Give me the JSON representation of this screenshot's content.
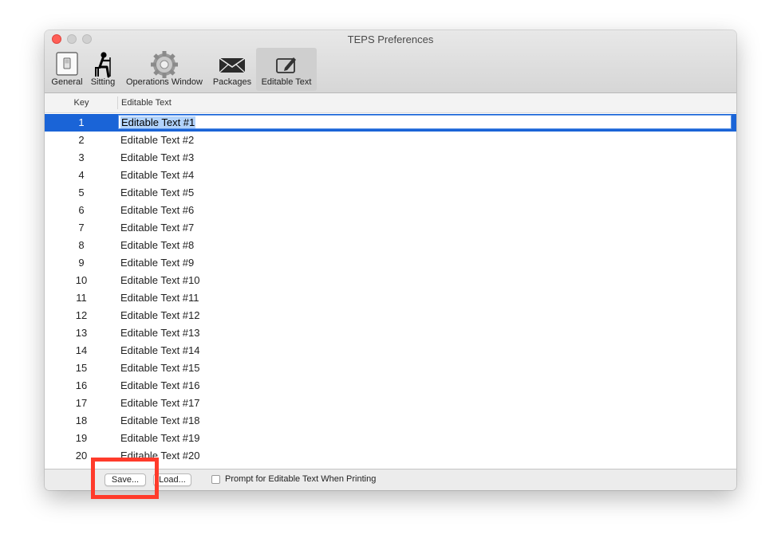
{
  "window": {
    "title": "TEPS Preferences"
  },
  "toolbar": {
    "items": [
      {
        "label": "General",
        "icon": "switch-icon"
      },
      {
        "label": "Sitting",
        "icon": "person-sitting-icon"
      },
      {
        "label": "Operations Window",
        "icon": "gear-icon"
      },
      {
        "label": "Packages",
        "icon": "envelope-icon"
      },
      {
        "label": "Editable Text",
        "icon": "pencil-edit-icon",
        "selected": true
      }
    ]
  },
  "table": {
    "columns": [
      "Key",
      "Editable Text"
    ],
    "rows": [
      {
        "key": "1",
        "text": "Editable Text #1"
      },
      {
        "key": "2",
        "text": "Editable Text #2"
      },
      {
        "key": "3",
        "text": "Editable Text #3"
      },
      {
        "key": "4",
        "text": "Editable Text #4"
      },
      {
        "key": "5",
        "text": "Editable Text #5"
      },
      {
        "key": "6",
        "text": "Editable Text #6"
      },
      {
        "key": "7",
        "text": "Editable Text #7"
      },
      {
        "key": "8",
        "text": "Editable Text #8"
      },
      {
        "key": "9",
        "text": "Editable Text #9"
      },
      {
        "key": "10",
        "text": "Editable Text #10"
      },
      {
        "key": "11",
        "text": "Editable Text #11"
      },
      {
        "key": "12",
        "text": "Editable Text #12"
      },
      {
        "key": "13",
        "text": "Editable Text #13"
      },
      {
        "key": "14",
        "text": "Editable Text #14"
      },
      {
        "key": "15",
        "text": "Editable Text #15"
      },
      {
        "key": "16",
        "text": "Editable Text #16"
      },
      {
        "key": "17",
        "text": "Editable Text #17"
      },
      {
        "key": "18",
        "text": "Editable Text #18"
      },
      {
        "key": "19",
        "text": "Editable Text #19"
      },
      {
        "key": "20",
        "text": "Editable Text #20"
      }
    ]
  },
  "bottom": {
    "save_label": "Save...",
    "load_label": "Load...",
    "prompt_label": "Prompt for Editable Text When Printing",
    "prompt_checked": false
  },
  "colors": {
    "selection": "#1a64d7",
    "highlight_box": "#ff3b2b",
    "close_button": "#ff5f57"
  }
}
